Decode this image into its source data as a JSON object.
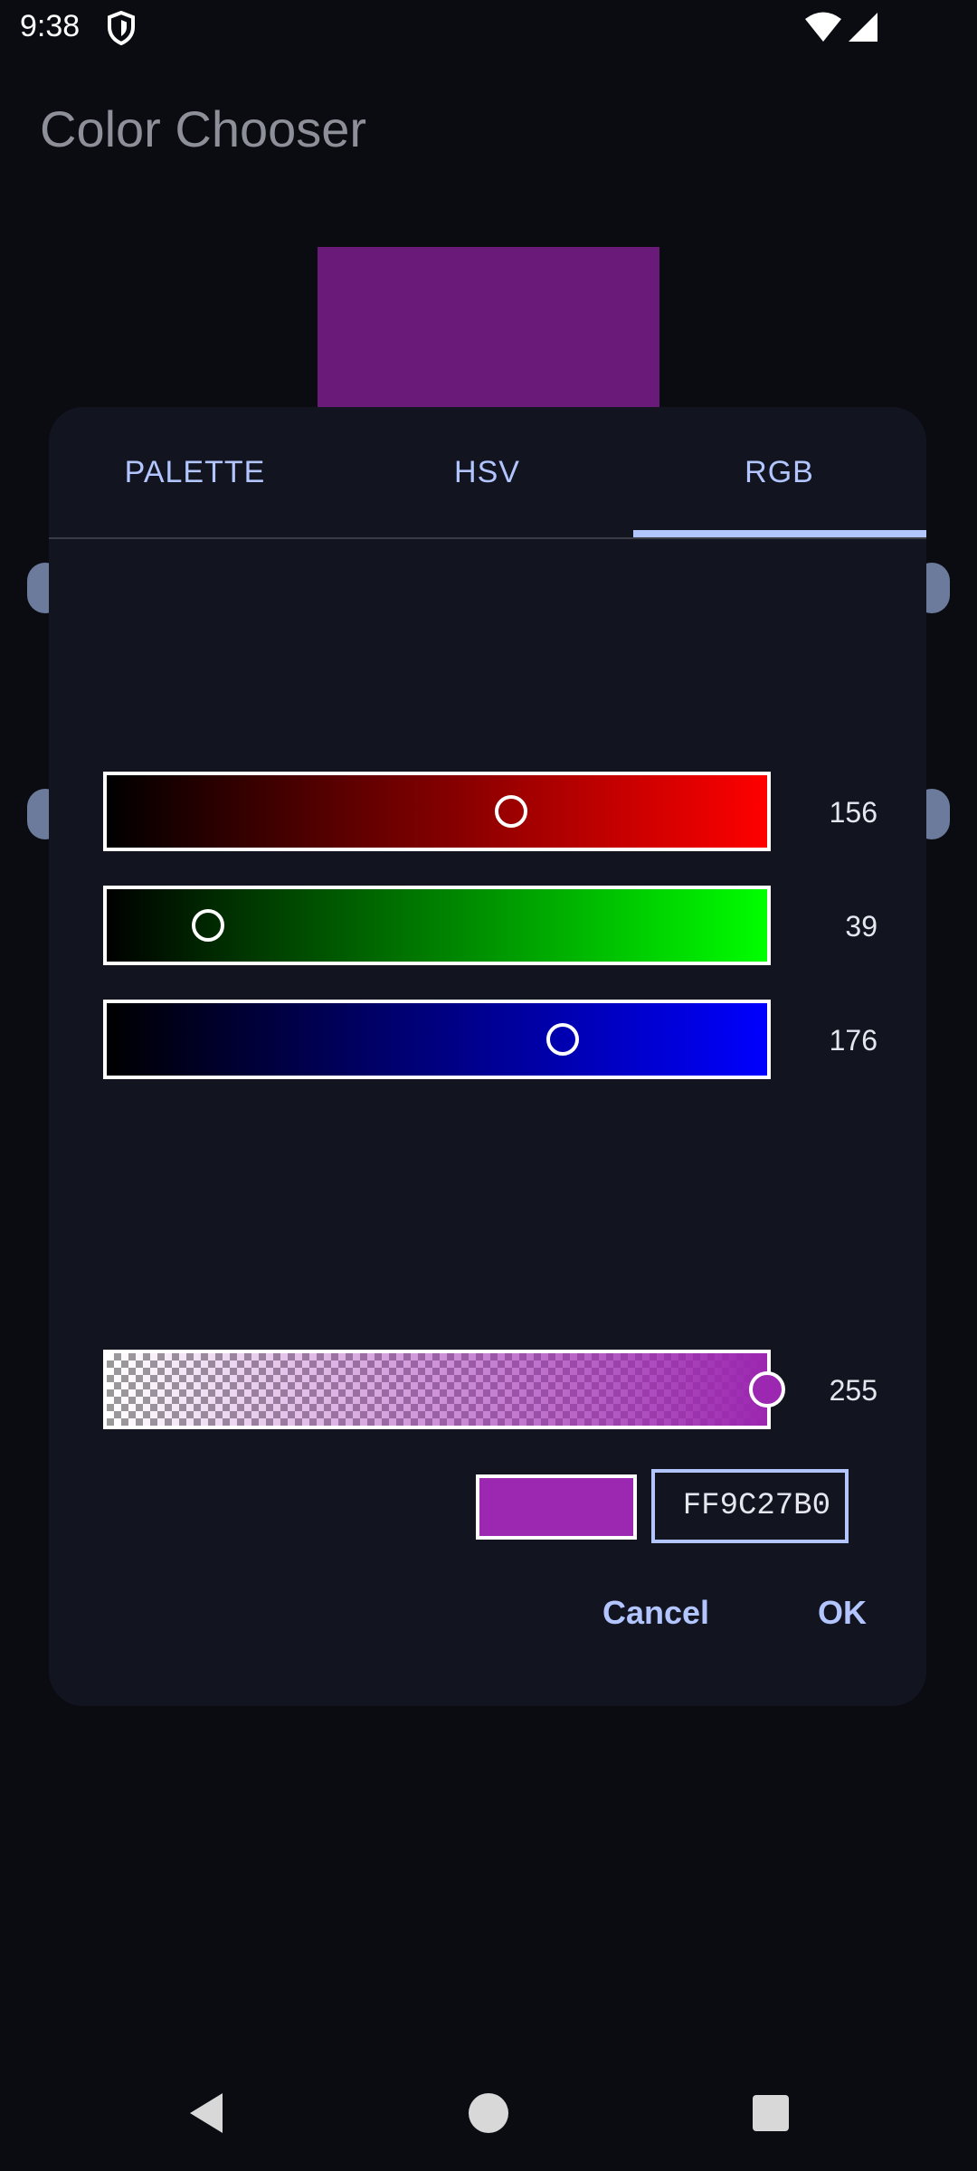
{
  "status_bar": {
    "time": "9:38",
    "icons": [
      "shield-icon",
      "wifi-icon",
      "signal-icon"
    ]
  },
  "app": {
    "title": "Color Chooser",
    "preview_color": "#6a1b7a"
  },
  "dialog": {
    "tabs": [
      {
        "label": "PALETTE",
        "selected": false
      },
      {
        "label": "HSV",
        "selected": false
      },
      {
        "label": "RGB",
        "selected": true
      }
    ],
    "sliders": {
      "red": {
        "value": "156",
        "fraction": 0.612,
        "gradient_end": "#ff0000"
      },
      "green": {
        "value": "39",
        "fraction": 0.153,
        "gradient_end": "#00ff00"
      },
      "blue": {
        "value": "176",
        "fraction": 0.69,
        "gradient_end": "#0000ff"
      },
      "alpha": {
        "value": "255",
        "fraction": 1.0
      }
    },
    "result_color": "#9c27b0",
    "hex_value": "FF9C27B0",
    "buttons": {
      "cancel": "Cancel",
      "ok": "OK"
    },
    "accent_color": "#b2c5ff"
  },
  "nav_bar": {
    "icons": [
      "back-icon",
      "home-icon",
      "recents-icon"
    ]
  }
}
